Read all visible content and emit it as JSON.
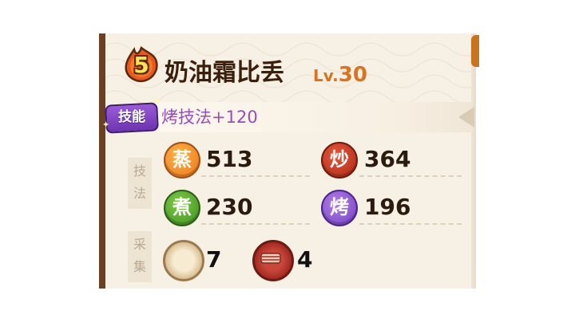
{
  "chef": {
    "rarity": "5",
    "name": "奶油霜比丢",
    "level_prefix": "Lv.",
    "level": "30"
  },
  "skill": {
    "badge_label": "技能",
    "description": "烤技法+120"
  },
  "sections": {
    "technique_label_1": "技",
    "technique_label_2": "法",
    "gather_label_1": "采",
    "gather_label_2": "集"
  },
  "techniques": [
    {
      "icon_char": "蒸",
      "icon": "steam-icon",
      "value": "513"
    },
    {
      "icon_char": "炒",
      "icon": "stir-fry-icon",
      "value": "364"
    },
    {
      "icon_char": "煮",
      "icon": "boil-icon",
      "value": "230"
    },
    {
      "icon_char": "烤",
      "icon": "roast-icon",
      "value": "196"
    }
  ],
  "materials": [
    {
      "icon": "bun-icon",
      "value": "7"
    },
    {
      "icon": "meat-icon",
      "value": "4"
    }
  ],
  "colors": {
    "panel_bg": "#f7f0e4",
    "name_text": "#3b1f0d",
    "level_text": "#d9731f",
    "skill_text": "#9a4db8",
    "skill_badge": "#7a3cbf"
  }
}
